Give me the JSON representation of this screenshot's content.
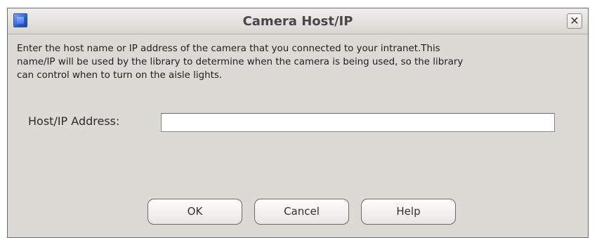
{
  "window": {
    "title": "Camera Host/IP",
    "close_label": "✕"
  },
  "message": {
    "lines": [
      "Enter the host name or IP address of the camera that you connected to your intranet.This",
      "name/IP will be used by the library to determine when the camera is being used, so the library",
      "can control when to turn on the aisle lights."
    ]
  },
  "form": {
    "host_label": "Host/IP Address:",
    "host_value": ""
  },
  "buttons": {
    "ok": "OK",
    "cancel": "Cancel",
    "help": "Help"
  }
}
